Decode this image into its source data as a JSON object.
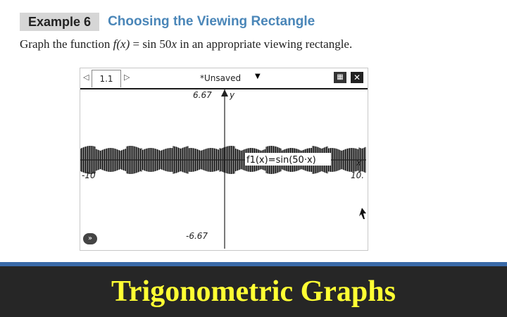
{
  "example": {
    "badge": "Example 6",
    "title": "Choosing the Viewing Rectangle",
    "text_before": "Graph the function ",
    "func_expr": "f(x)",
    "text_mid": " = sin 50",
    "var_x": "x",
    "text_after": " in an appropriate viewing rectangle."
  },
  "calculator": {
    "tab_label": "1.1",
    "tab_prev_arrow": "◁",
    "tab_next_arrow": "▷",
    "doc_title": "*Unsaved",
    "doc_caret": "▼",
    "tool_icon": "tools-icon",
    "close_icon": "close-icon",
    "y_max_label": "6.67",
    "y_min_label": "-6.67",
    "y_axis_label": "y",
    "x_min_label": "-10",
    "x_max_label": "10.",
    "x_axis_label": "x",
    "function_label": "f1(x)=sin(50·x)",
    "nav_symbol": "»"
  },
  "banner": {
    "title": "Trigonometric Graphs",
    "bg_color": "#262626",
    "text_color": "#ffff33",
    "accent_color": "#3a6aa8"
  }
}
